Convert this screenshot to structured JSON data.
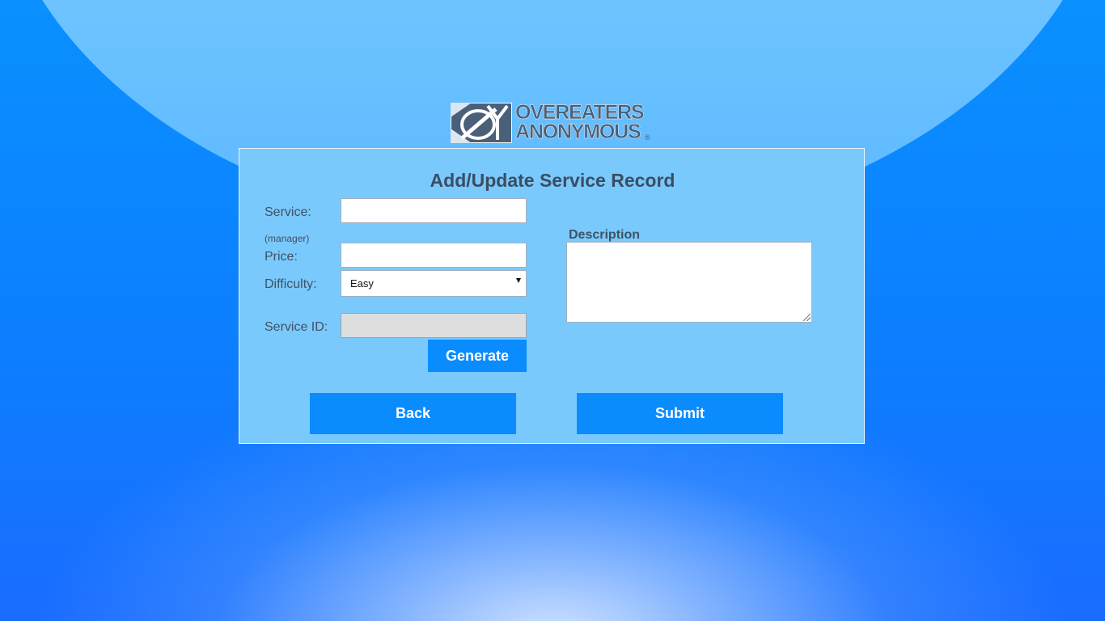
{
  "logo": {
    "line1": "OVEREATERS",
    "line2": "ANONYMOUS",
    "registered_mark": "®",
    "color": "#4a6079"
  },
  "form": {
    "title": "Add/Update Service Record",
    "service": {
      "label": "Service:",
      "value": ""
    },
    "manager_note": "(manager)",
    "price": {
      "label": "Price:",
      "value": ""
    },
    "difficulty": {
      "label": "Difficulty:",
      "selected": "Easy"
    },
    "service_id": {
      "label": "Service ID:",
      "value": ""
    },
    "generate_label": "Generate",
    "description": {
      "label": "Description",
      "value": ""
    },
    "back_label": "Back",
    "submit_label": "Submit"
  },
  "colors": {
    "button": "#0a8cff",
    "panel": "#7ac9fc",
    "text": "#3f5266"
  }
}
